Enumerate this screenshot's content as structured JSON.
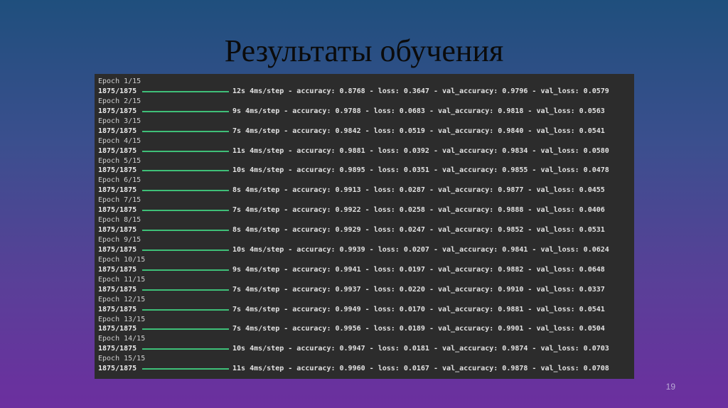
{
  "slide": {
    "title": "Результаты обучения",
    "page_number": "19"
  },
  "colors": {
    "background_top": "#1f4f7d",
    "background_bottom": "#6c2f9f",
    "console_bg": "#2c2c2c",
    "progress_bar": "#3fbf78"
  },
  "log": [
    {
      "epoch": "Epoch 1/15",
      "steps": "1875/1875",
      "metrics": "12s 4ms/step - accuracy: 0.8768 - loss: 0.3647 - val_accuracy: 0.9796 - val_loss: 0.0579"
    },
    {
      "epoch": "Epoch 2/15",
      "steps": "1875/1875",
      "metrics": "9s 4ms/step - accuracy: 0.9788 - loss: 0.0683 - val_accuracy: 0.9818 - val_loss: 0.0563"
    },
    {
      "epoch": "Epoch 3/15",
      "steps": "1875/1875",
      "metrics": "7s 4ms/step - accuracy: 0.9842 - loss: 0.0519 - val_accuracy: 0.9840 - val_loss: 0.0541"
    },
    {
      "epoch": "Epoch 4/15",
      "steps": "1875/1875",
      "metrics": "11s 4ms/step - accuracy: 0.9881 - loss: 0.0392 - val_accuracy: 0.9834 - val_loss: 0.0580"
    },
    {
      "epoch": "Epoch 5/15",
      "steps": "1875/1875",
      "metrics": "10s 4ms/step - accuracy: 0.9895 - loss: 0.0351 - val_accuracy: 0.9855 - val_loss: 0.0478"
    },
    {
      "epoch": "Epoch 6/15",
      "steps": "1875/1875",
      "metrics": "8s 4ms/step - accuracy: 0.9913 - loss: 0.0287 - val_accuracy: 0.9877 - val_loss: 0.0455"
    },
    {
      "epoch": "Epoch 7/15",
      "steps": "1875/1875",
      "metrics": "7s 4ms/step - accuracy: 0.9922 - loss: 0.0258 - val_accuracy: 0.9888 - val_loss: 0.0406"
    },
    {
      "epoch": "Epoch 8/15",
      "steps": "1875/1875",
      "metrics": "8s 4ms/step - accuracy: 0.9929 - loss: 0.0247 - val_accuracy: 0.9852 - val_loss: 0.0531"
    },
    {
      "epoch": "Epoch 9/15",
      "steps": "1875/1875",
      "metrics": "10s 4ms/step - accuracy: 0.9939 - loss: 0.0207 - val_accuracy: 0.9841 - val_loss: 0.0624"
    },
    {
      "epoch": "Epoch 10/15",
      "steps": "1875/1875",
      "metrics": "9s 4ms/step - accuracy: 0.9941 - loss: 0.0197 - val_accuracy: 0.9882 - val_loss: 0.0648"
    },
    {
      "epoch": "Epoch 11/15",
      "steps": "1875/1875",
      "metrics": "7s 4ms/step - accuracy: 0.9937 - loss: 0.0220 - val_accuracy: 0.9910 - val_loss: 0.0337"
    },
    {
      "epoch": "Epoch 12/15",
      "steps": "1875/1875",
      "metrics": "7s 4ms/step - accuracy: 0.9949 - loss: 0.0170 - val_accuracy: 0.9881 - val_loss: 0.0541"
    },
    {
      "epoch": "Epoch 13/15",
      "steps": "1875/1875",
      "metrics": "7s 4ms/step - accuracy: 0.9956 - loss: 0.0189 - val_accuracy: 0.9901 - val_loss: 0.0504"
    },
    {
      "epoch": "Epoch 14/15",
      "steps": "1875/1875",
      "metrics": "10s 4ms/step - accuracy: 0.9947 - loss: 0.0181 - val_accuracy: 0.9874 - val_loss: 0.0703"
    },
    {
      "epoch": "Epoch 15/15",
      "steps": "1875/1875",
      "metrics": "11s 4ms/step - accuracy: 0.9960 - loss: 0.0167 - val_accuracy: 0.9878 - val_loss: 0.0708"
    }
  ]
}
